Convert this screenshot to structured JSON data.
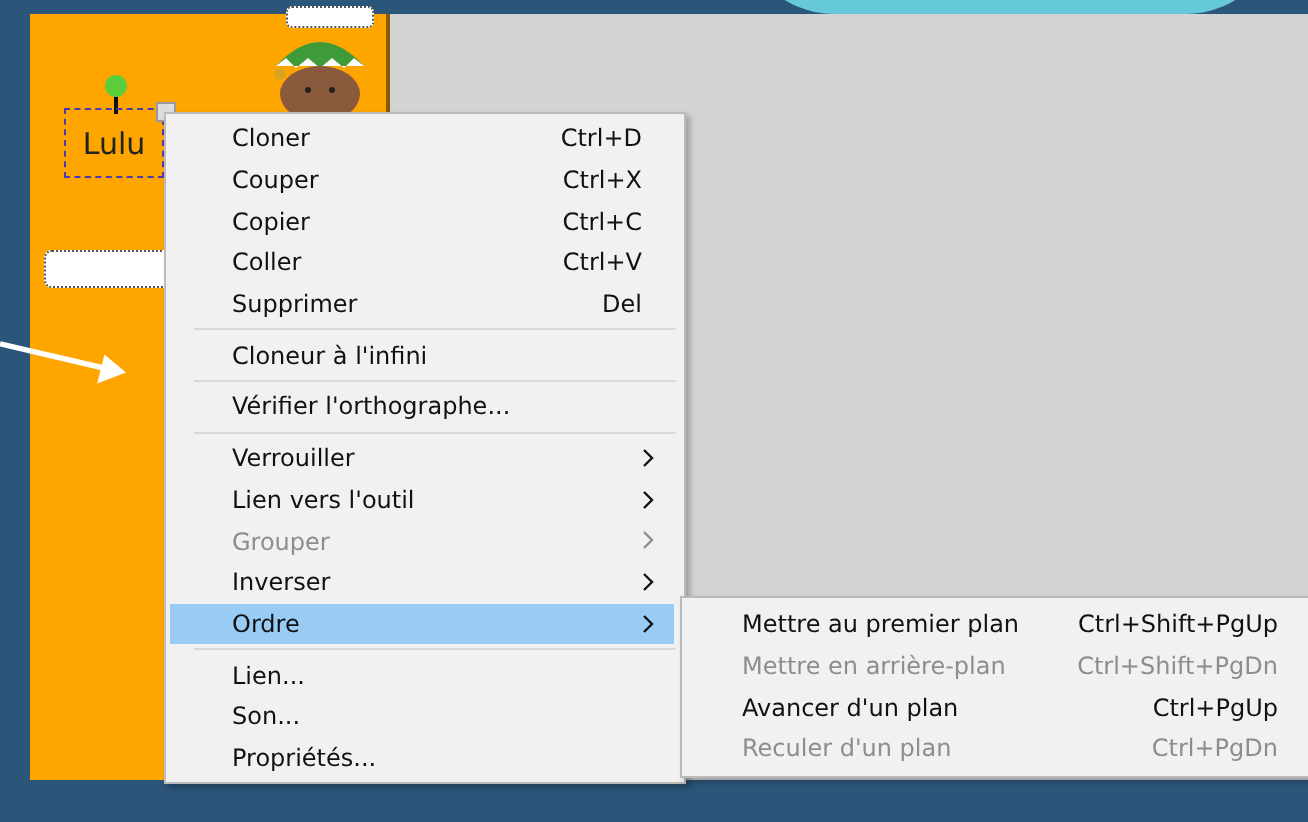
{
  "canvas": {
    "text_box": {
      "text": "Lulu"
    }
  },
  "context_menu": {
    "items": [
      {
        "kind": "item",
        "label": "Cloner",
        "shortcut": "Ctrl+D",
        "disabled": false,
        "selected": false,
        "has_submenu": false
      },
      {
        "kind": "item",
        "label": "Couper",
        "shortcut": "Ctrl+X",
        "disabled": false,
        "selected": false,
        "has_submenu": false
      },
      {
        "kind": "item",
        "label": "Copier",
        "shortcut": "Ctrl+C",
        "disabled": false,
        "selected": false,
        "has_submenu": false
      },
      {
        "kind": "item",
        "label": "Coller",
        "shortcut": "Ctrl+V",
        "disabled": false,
        "selected": false,
        "has_submenu": false
      },
      {
        "kind": "item",
        "label": "Supprimer",
        "shortcut": "Del",
        "disabled": false,
        "selected": false,
        "has_submenu": false
      },
      {
        "kind": "separator"
      },
      {
        "kind": "item",
        "label": "Cloneur à l'infini",
        "disabled": false,
        "selected": false,
        "has_submenu": false
      },
      {
        "kind": "separator"
      },
      {
        "kind": "item",
        "label": "Vérifier l'orthographe...",
        "disabled": false,
        "selected": false,
        "has_submenu": false
      },
      {
        "kind": "separator"
      },
      {
        "kind": "item",
        "label": "Verrouiller",
        "disabled": false,
        "selected": false,
        "has_submenu": true
      },
      {
        "kind": "item",
        "label": "Lien vers l'outil",
        "disabled": false,
        "selected": false,
        "has_submenu": true
      },
      {
        "kind": "item",
        "label": "Grouper",
        "disabled": true,
        "selected": false,
        "has_submenu": true
      },
      {
        "kind": "item",
        "label": "Inverser",
        "disabled": false,
        "selected": false,
        "has_submenu": true
      },
      {
        "kind": "item",
        "label": "Ordre",
        "disabled": false,
        "selected": true,
        "has_submenu": true
      },
      {
        "kind": "separator"
      },
      {
        "kind": "item",
        "label": "Lien...",
        "disabled": false,
        "selected": false,
        "has_submenu": false
      },
      {
        "kind": "item",
        "label": "Son...",
        "disabled": false,
        "selected": false,
        "has_submenu": false
      },
      {
        "kind": "item",
        "label": "Propriétés...",
        "disabled": false,
        "selected": false,
        "has_submenu": false
      }
    ]
  },
  "submenu": {
    "items": [
      {
        "label": "Mettre au premier plan",
        "shortcut": "Ctrl+Shift+PgUp",
        "disabled": false
      },
      {
        "label": "Mettre en arrière-plan",
        "shortcut": "Ctrl+Shift+PgDn",
        "disabled": true
      },
      {
        "label": "Avancer d'un plan",
        "shortcut": "Ctrl+PgUp",
        "disabled": false
      },
      {
        "label": "Reculer d'un plan",
        "shortcut": "Ctrl+PgDn",
        "disabled": true
      }
    ]
  }
}
